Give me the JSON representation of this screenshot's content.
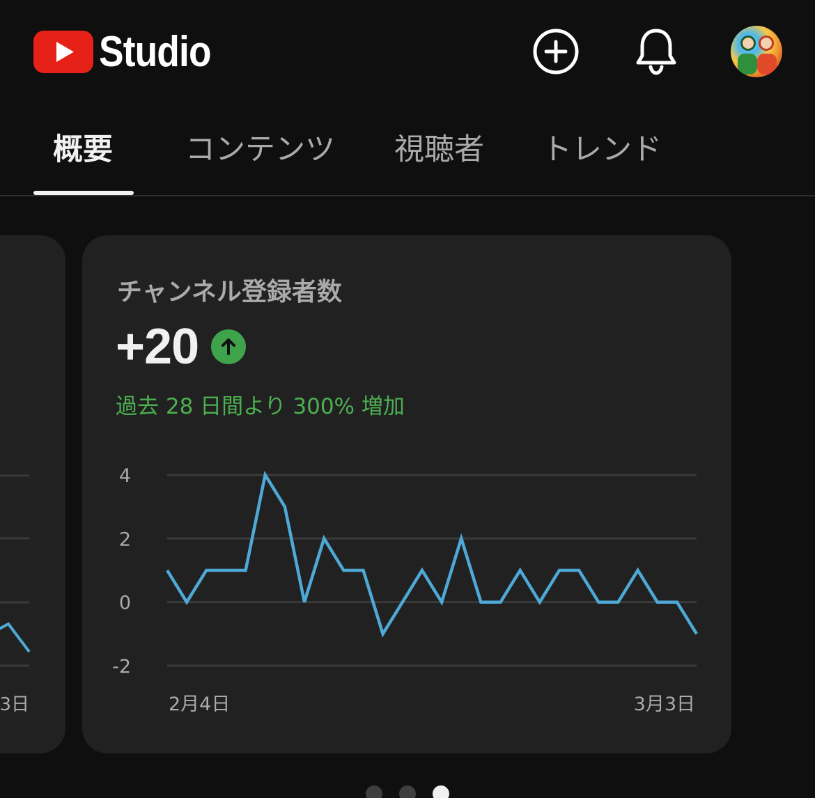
{
  "app": {
    "brand_text": "Studio"
  },
  "header": {
    "create_icon": "plus-circle-icon",
    "notifications_icon": "bell-icon",
    "avatar": "channel-avatar"
  },
  "tabs": [
    {
      "label": "概要",
      "active": true
    },
    {
      "label": "コンテンツ",
      "active": false
    },
    {
      "label": "視聴者",
      "active": false
    },
    {
      "label": "トレンド",
      "active": false
    }
  ],
  "left_card": {
    "x_label": "3日"
  },
  "card": {
    "title": "チャンネル登録者数",
    "value": "+20",
    "trend_icon": "arrow-up-icon",
    "subtitle": "過去 28 日間より 300% 増加"
  },
  "chart_data": {
    "type": "line",
    "y_ticks": [
      "4",
      "2",
      "0",
      "-2"
    ],
    "ylim": [
      -2,
      4
    ],
    "x_start_label": "2月4日",
    "x_end_label": "3月3日",
    "grid": true,
    "color": "#4ea9d6",
    "values": [
      1,
      0,
      1,
      1,
      1,
      4,
      3,
      0,
      2,
      1,
      1,
      -1,
      0,
      1,
      0,
      2,
      0,
      0,
      1,
      0,
      1,
      1,
      0,
      0,
      1,
      0,
      0,
      -1
    ]
  },
  "pagination": {
    "count": 3,
    "active_index": 2
  },
  "colors": {
    "accent_green": "#4caf50",
    "line_blue": "#4ea9d6",
    "youtube_red": "#e62117"
  }
}
